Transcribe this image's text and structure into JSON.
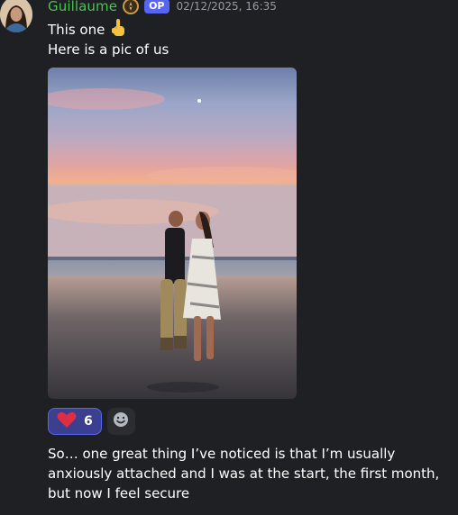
{
  "message": {
    "username": "Guillaume",
    "badge": "OP",
    "timestamp": "02/12/2025, 16:35",
    "line1": "This one",
    "line2": "Here is a pic of us",
    "body": "So… one great thing I’ve noticed is that I’m usually anxiously attached and I was at the start, the first month,  but now I feel secure"
  },
  "reactions": [
    {
      "emoji": "heart-icon",
      "count": "6",
      "active": true
    }
  ],
  "icons": {
    "role": "compass-icon",
    "pointing": "pointing-up-hand-icon",
    "add_reaction": "smiley-add-reaction-icon"
  },
  "colors": {
    "username": "#4fbf58",
    "badge": "#5865f2",
    "reaction_bg": "#3b3f8f",
    "background": "#1f2023"
  }
}
